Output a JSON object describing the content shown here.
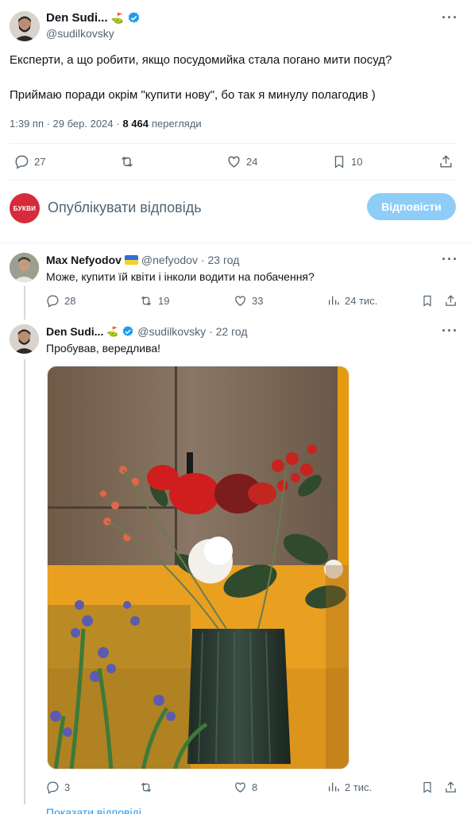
{
  "main_tweet": {
    "display_name": "Den Sudi...",
    "handle": "@sudilkovsky",
    "text_line1": "Експерти, а що робити, якщо посудомийка стала погано мити посуд?",
    "text_line2": "Приймаю поради окрім \"купити нову\", бо так я минулу полагодив )",
    "time": "1:39 пп · 29 бер. 2024 ·",
    "views_count": "8 464",
    "views_label": "перегляди",
    "replies": "27",
    "reposts": "",
    "likes": "24",
    "bookmarks": "10"
  },
  "compose": {
    "avatar_label": "БУКВИ",
    "placeholder": "Опублікувати відповідь",
    "button_label": "Відповісти"
  },
  "reply1": {
    "display_name": "Max Nefyodov",
    "handle": "@nefyodov",
    "time": "· 23 год",
    "text": "Може, купити їй квіти і інколи водити на побачення?",
    "replies": "28",
    "reposts": "19",
    "likes": "33",
    "views": "24 тис."
  },
  "reply2": {
    "display_name": "Den Sudi...",
    "handle": "@sudilkovsky",
    "time": "· 22 год",
    "text": "Пробував, вередлива!",
    "replies": "3",
    "reposts": "",
    "likes": "8",
    "views": "2 тис."
  },
  "show_replies": "Показати відповіді",
  "colors": {
    "accent": "#1d9bf0",
    "button_disabled": "#8ecdf8",
    "brand_red": "#d62b3a"
  }
}
